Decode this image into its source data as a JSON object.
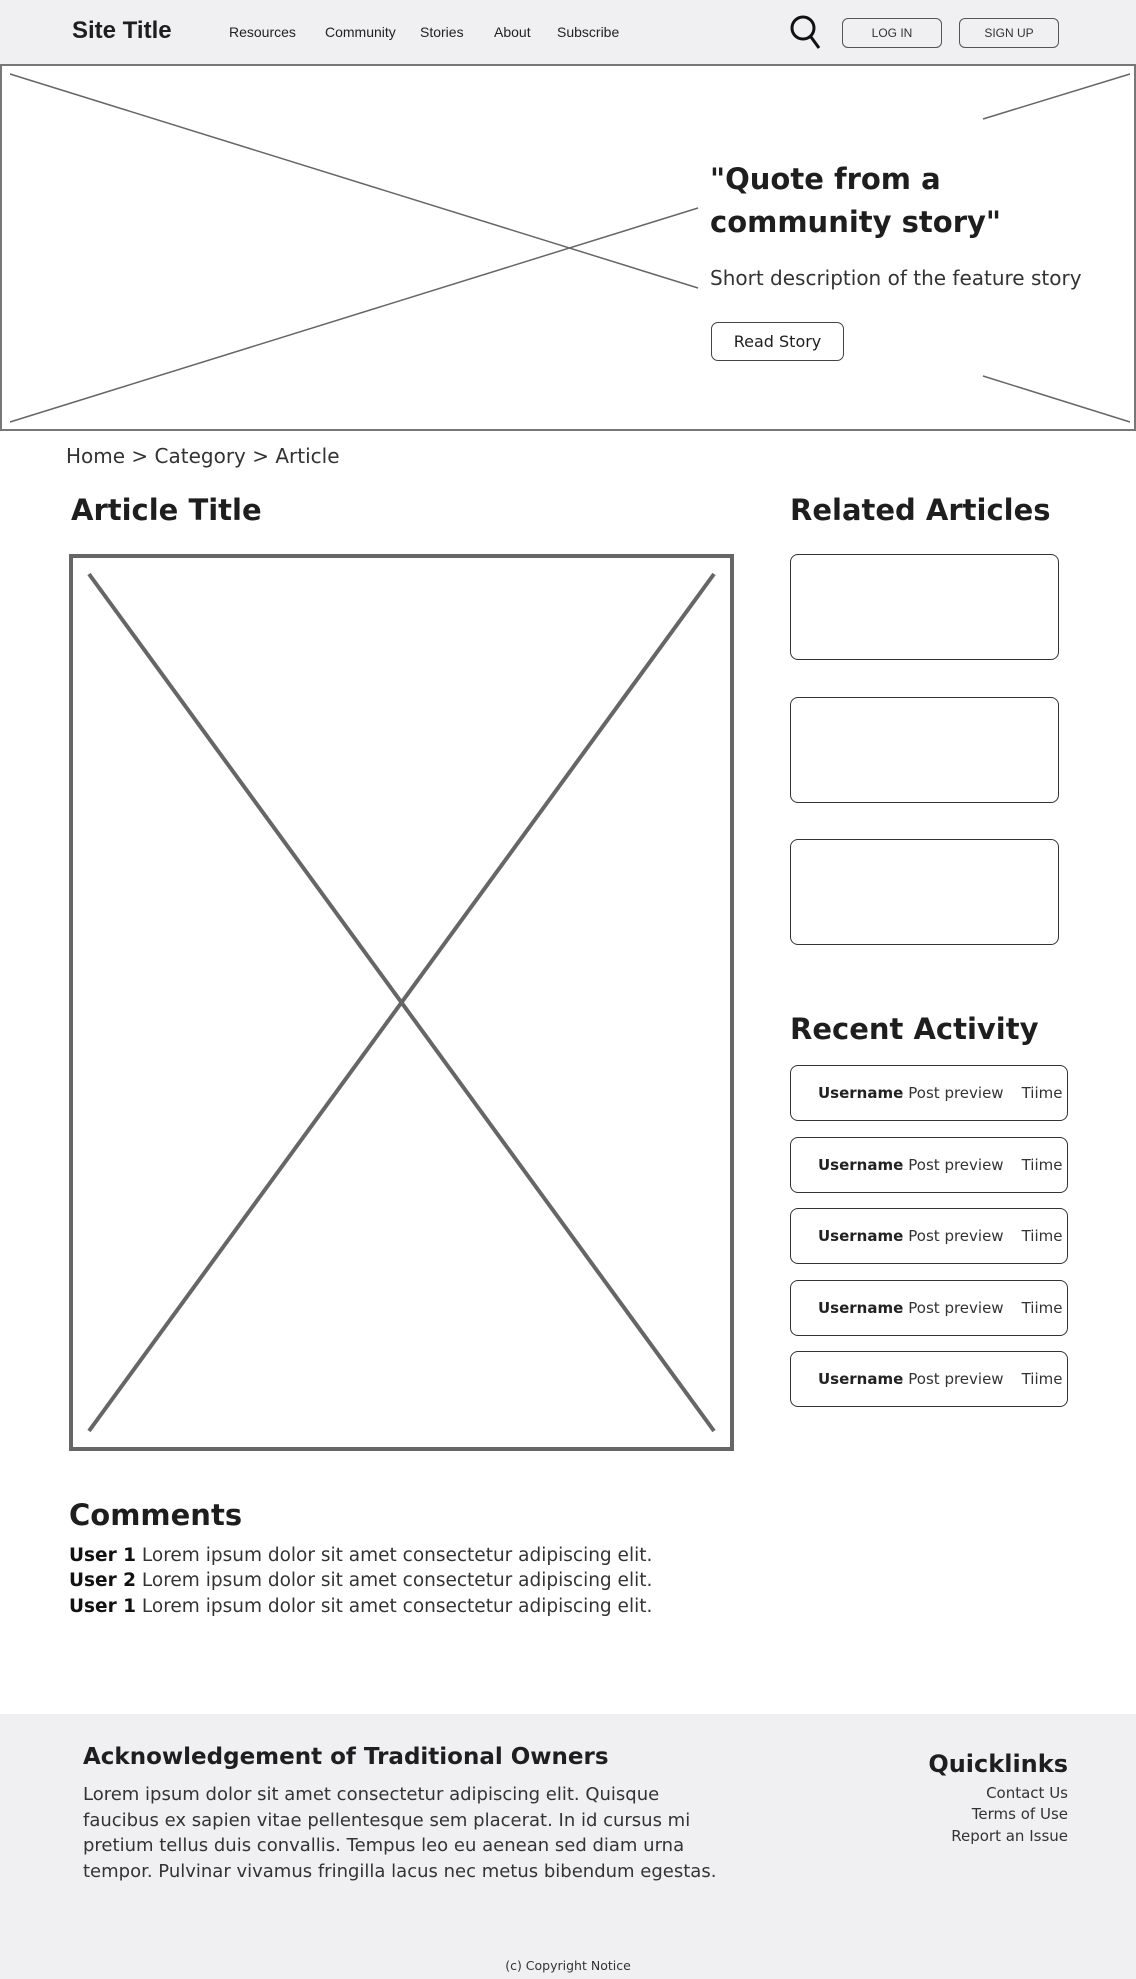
{
  "header": {
    "site_title": "Site Title",
    "nav": [
      "Resources",
      "Community",
      "Stories",
      "About",
      "Subscribe"
    ],
    "search_icon": "search-icon",
    "login": "LOG IN",
    "signup": "SIGN UP"
  },
  "hero": {
    "quote": "\"Quote from a community story\"",
    "description": "Short description of the feature story",
    "button": "Read Story"
  },
  "breadcrumb": "Home > Category > Article",
  "article": {
    "title": "Article Title"
  },
  "related": {
    "title": "Related Articles"
  },
  "activity": {
    "title": "Recent Activity",
    "items": [
      {
        "user": "Username",
        "preview": "Post preview",
        "time": "Tiime"
      },
      {
        "user": "Username",
        "preview": "Post preview",
        "time": "Tiime"
      },
      {
        "user": "Username",
        "preview": "Post preview",
        "time": "Tiime"
      },
      {
        "user": "Username",
        "preview": "Post preview",
        "time": "Tiime"
      },
      {
        "user": "Username",
        "preview": "Post preview",
        "time": "Tiime"
      }
    ]
  },
  "comments": {
    "title": "Comments",
    "items": [
      {
        "user": "User 1",
        "text": "Lorem ipsum dolor sit amet consectetur adipiscing elit."
      },
      {
        "user": "User 2",
        "text": "Lorem ipsum dolor sit amet consectetur adipiscing elit."
      },
      {
        "user": "User 1",
        "text": "Lorem ipsum dolor sit amet consectetur adipiscing elit."
      }
    ]
  },
  "footer": {
    "ack_title": "Acknowledgement of Traditional Owners",
    "ack_text": "Lorem ipsum dolor sit amet consectetur adipiscing elit. Quisque faucibus ex sapien vitae pellentesque sem placerat. In id cursus mi pretium tellus duis convallis. Tempus leo eu aenean sed diam urna tempor. Pulvinar vivamus fringilla lacus nec metus bibendum egestas.",
    "quicklinks_title": "Quicklinks",
    "quicklinks": [
      "Contact Us",
      "Terms of Use",
      "Report an Issue"
    ],
    "copyright": "(c) Copyright Notice"
  }
}
